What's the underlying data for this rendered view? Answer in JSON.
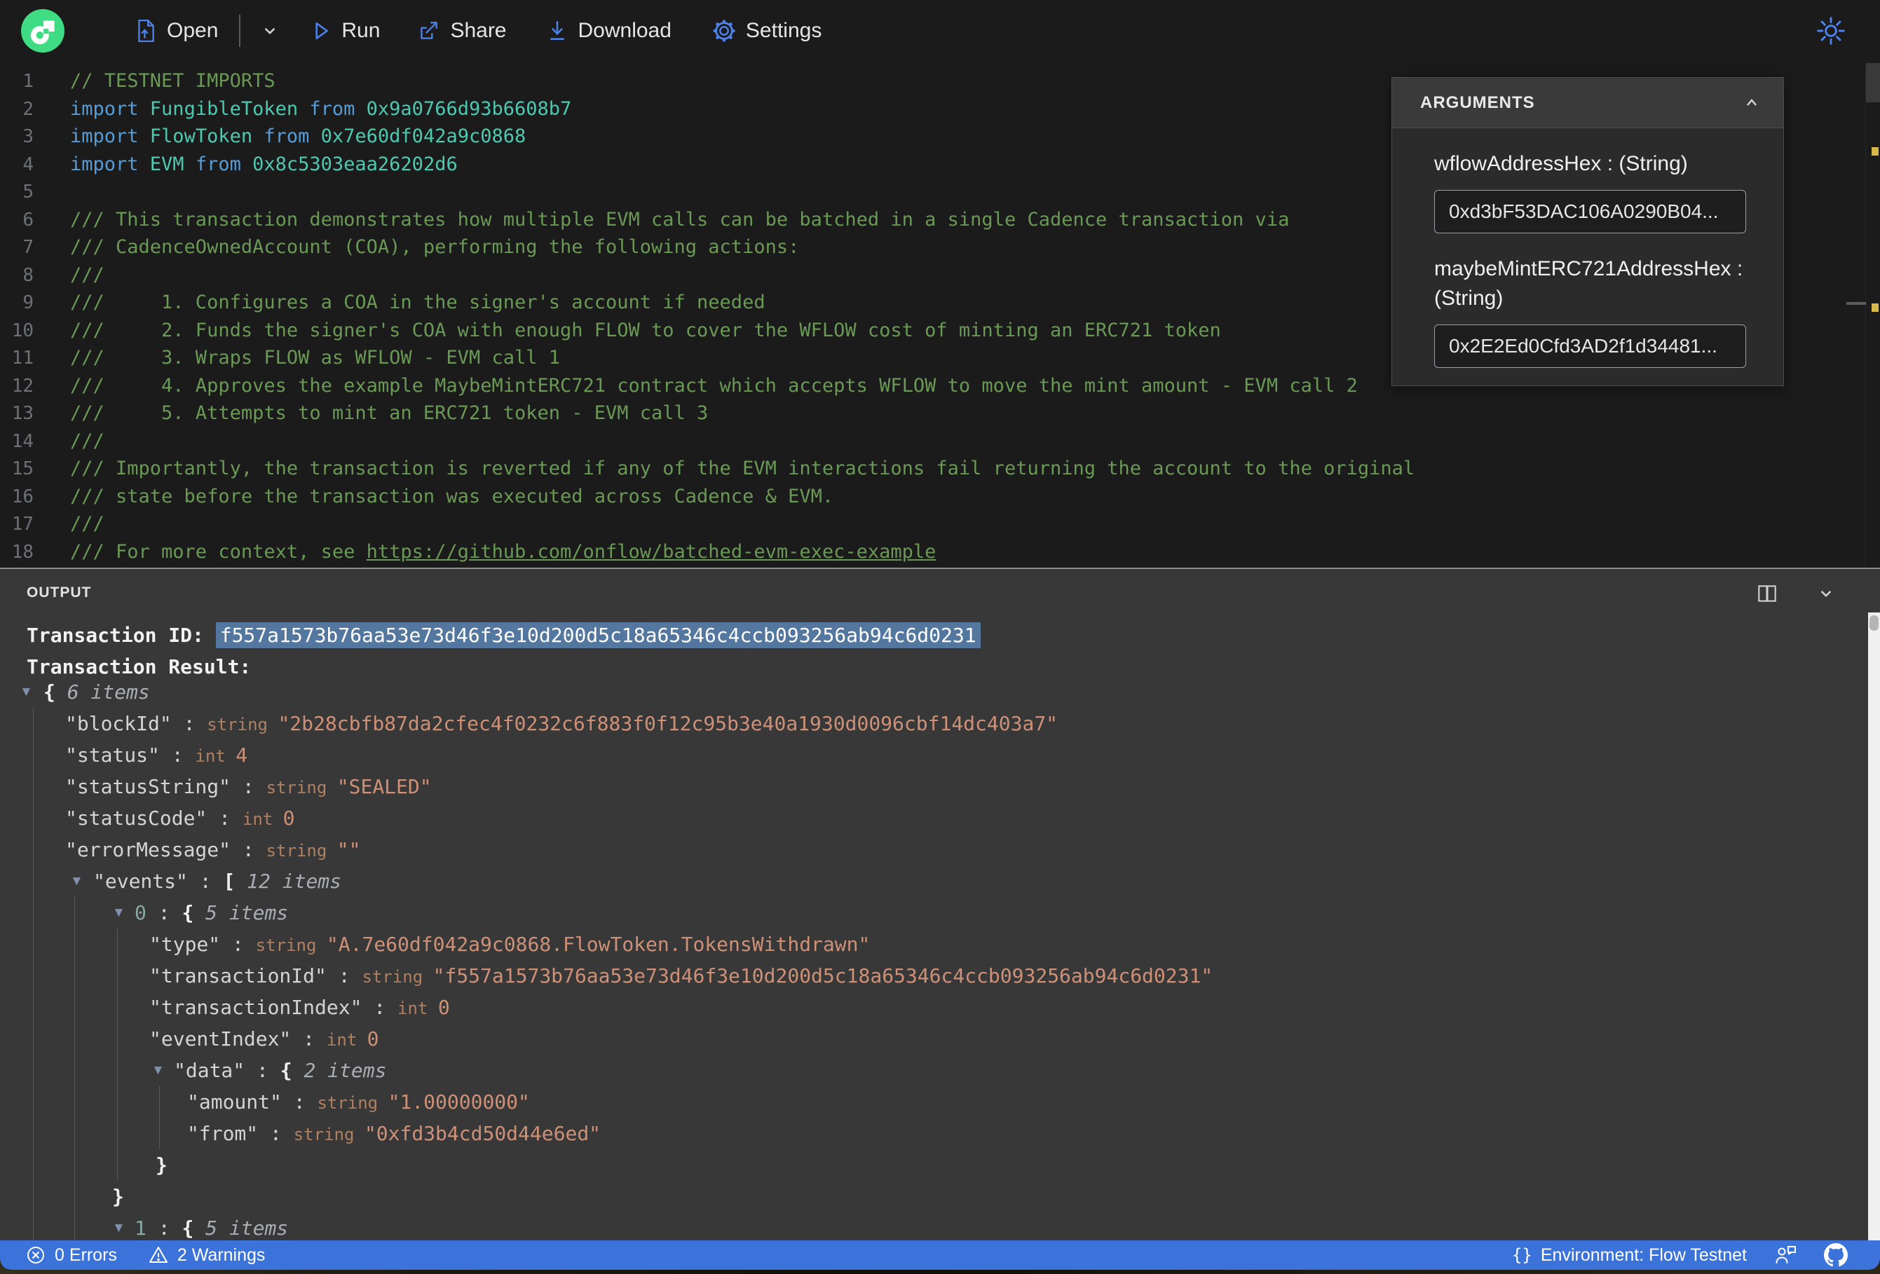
{
  "colors": {
    "accent_blue": "#4d82ec",
    "flow_green": "#3fdc84",
    "status_bar_blue": "#3b73da",
    "selection_blue": "#54779f",
    "string_orange": "#CE9178",
    "comment_green": "#6A9955",
    "keyword_blue": "#569CD6",
    "type_teal": "#4EC9B0",
    "warning_yellow": "#d7b94b"
  },
  "toolbar": {
    "open": "Open",
    "run": "Run",
    "share": "Share",
    "download": "Download",
    "settings": "Settings"
  },
  "editor": {
    "lines": [
      {
        "n": "1",
        "toks": [
          [
            "cm",
            "// TESTNET IMPORTS"
          ]
        ]
      },
      {
        "n": "2",
        "toks": [
          [
            "kw",
            "import "
          ],
          [
            "ty",
            "FungibleToken "
          ],
          [
            "kw",
            "from "
          ],
          [
            "ty",
            "0x9a0766d93b6608b7"
          ]
        ]
      },
      {
        "n": "3",
        "toks": [
          [
            "kw",
            "import "
          ],
          [
            "ty",
            "FlowToken "
          ],
          [
            "kw",
            "from "
          ],
          [
            "ty",
            "0x7e60df042a9c0868"
          ]
        ]
      },
      {
        "n": "4",
        "toks": [
          [
            "kw",
            "import "
          ],
          [
            "ty",
            "EVM "
          ],
          [
            "kw",
            "from "
          ],
          [
            "ty",
            "0x8c5303eaa26202d6"
          ]
        ]
      },
      {
        "n": "5",
        "toks": []
      },
      {
        "n": "6",
        "toks": [
          [
            "cm",
            "/// This transaction demonstrates how multiple EVM calls can be batched in a single Cadence transaction via"
          ]
        ]
      },
      {
        "n": "7",
        "toks": [
          [
            "cm",
            "/// CadenceOwnedAccount (COA), performing the following actions:"
          ]
        ]
      },
      {
        "n": "8",
        "toks": [
          [
            "cm",
            "///"
          ]
        ]
      },
      {
        "n": "9",
        "toks": [
          [
            "cm",
            "///     1. Configures a COA in the signer's account if needed"
          ]
        ]
      },
      {
        "n": "10",
        "toks": [
          [
            "cm",
            "///     2. Funds the signer's COA with enough FLOW to cover the WFLOW cost of minting an ERC721 token"
          ]
        ]
      },
      {
        "n": "11",
        "toks": [
          [
            "cm",
            "///     3. Wraps FLOW as WFLOW - EVM call 1"
          ]
        ]
      },
      {
        "n": "12",
        "toks": [
          [
            "cm",
            "///     4. Approves the example MaybeMintERC721 contract which accepts WFLOW to move the mint amount - EVM call 2"
          ]
        ]
      },
      {
        "n": "13",
        "toks": [
          [
            "cm",
            "///     5. Attempts to mint an ERC721 token - EVM call 3"
          ]
        ]
      },
      {
        "n": "14",
        "toks": [
          [
            "cm",
            "///"
          ]
        ]
      },
      {
        "n": "15",
        "toks": [
          [
            "cm",
            "/// Importantly, the transaction is reverted if any of the EVM interactions fail returning the account to the original"
          ]
        ]
      },
      {
        "n": "16",
        "toks": [
          [
            "cm",
            "/// state before the transaction was executed across Cadence & EVM."
          ]
        ]
      },
      {
        "n": "17",
        "toks": [
          [
            "cm",
            "///"
          ]
        ]
      },
      {
        "n": "18",
        "toks": [
          [
            "cm",
            "/// For more context, see "
          ],
          [
            "lk",
            "https://github.com/onflow/batched-evm-exec-example"
          ]
        ]
      }
    ]
  },
  "arguments_panel": {
    "title": "ARGUMENTS",
    "args": [
      {
        "label": "wflowAddressHex : (String)",
        "value": "0xd3bF53DAC106A0290B04..."
      },
      {
        "label": "maybeMintERC721AddressHex : (String)",
        "value": "0x2E2Ed0Cfd3AD2f1d34481..."
      }
    ]
  },
  "output": {
    "title": "OUTPUT",
    "tx_id_label": "Transaction ID: ",
    "tx_id": "f557a1573b76aa53e73d46f3e10d200d5c18a65346c4ccb093256ab94c6d0231",
    "result_label": "Transaction Result:",
    "rows": [
      {
        "ind": 62,
        "tri": 28,
        "g": [],
        "toks": [
          [
            "b",
            "{ "
          ],
          [
            "i",
            "6 items"
          ]
        ]
      },
      {
        "ind": 93,
        "g": [
          47
        ],
        "toks": [
          [
            "k",
            "\"blockId\""
          ],
          [
            "p",
            " : "
          ],
          [
            "t",
            "string "
          ],
          [
            "s",
            "\"2b28cbfb87da2cfec4f0232c6f883f0f12c95b3e40a1930d0096cbf14dc403a7\""
          ]
        ]
      },
      {
        "ind": 93,
        "g": [
          47
        ],
        "toks": [
          [
            "k",
            "\"status\""
          ],
          [
            "p",
            " : "
          ],
          [
            "t",
            "int "
          ],
          [
            "n",
            "4"
          ]
        ]
      },
      {
        "ind": 93,
        "g": [
          47
        ],
        "toks": [
          [
            "k",
            "\"statusString\""
          ],
          [
            "p",
            " : "
          ],
          [
            "t",
            "string "
          ],
          [
            "s",
            "\"SEALED\""
          ]
        ]
      },
      {
        "ind": 93,
        "g": [
          47
        ],
        "toks": [
          [
            "k",
            "\"statusCode\""
          ],
          [
            "p",
            " : "
          ],
          [
            "t",
            "int "
          ],
          [
            "n",
            "0"
          ]
        ]
      },
      {
        "ind": 93,
        "g": [
          47
        ],
        "toks": [
          [
            "k",
            "\"errorMessage\""
          ],
          [
            "p",
            " : "
          ],
          [
            "t",
            "string "
          ],
          [
            "s",
            "\"\""
          ]
        ]
      },
      {
        "ind": 133,
        "tri": 100,
        "g": [
          47
        ],
        "toks": [
          [
            "k",
            "\"events\""
          ],
          [
            "p",
            " : "
          ],
          [
            "b",
            "[ "
          ],
          [
            "i",
            "12 items"
          ]
        ]
      },
      {
        "ind": 192,
        "tri": 160,
        "g": [
          47,
          106
        ],
        "toks": [
          [
            "x",
            "0"
          ],
          [
            "p",
            " : "
          ],
          [
            "b",
            "{ "
          ],
          [
            "i",
            "5 items"
          ]
        ]
      },
      {
        "ind": 213,
        "g": [
          47,
          106,
          167
        ],
        "toks": [
          [
            "k",
            "\"type\""
          ],
          [
            "p",
            " : "
          ],
          [
            "t",
            "string "
          ],
          [
            "s",
            "\"A.7e60df042a9c0868.FlowToken.TokensWithdrawn\""
          ]
        ]
      },
      {
        "ind": 213,
        "g": [
          47,
          106,
          167
        ],
        "toks": [
          [
            "k",
            "\"transactionId\""
          ],
          [
            "p",
            " : "
          ],
          [
            "t",
            "string "
          ],
          [
            "s",
            "\"f557a1573b76aa53e73d46f3e10d200d5c18a65346c4ccb093256ab94c6d0231\""
          ]
        ]
      },
      {
        "ind": 213,
        "g": [
          47,
          106,
          167
        ],
        "toks": [
          [
            "k",
            "\"transactionIndex\""
          ],
          [
            "p",
            " : "
          ],
          [
            "t",
            "int "
          ],
          [
            "n",
            "0"
          ]
        ]
      },
      {
        "ind": 213,
        "g": [
          47,
          106,
          167
        ],
        "toks": [
          [
            "k",
            "\"eventIndex\""
          ],
          [
            "p",
            " : "
          ],
          [
            "t",
            "int "
          ],
          [
            "n",
            "0"
          ]
        ]
      },
      {
        "ind": 248,
        "tri": 216,
        "g": [
          47,
          106,
          167
        ],
        "toks": [
          [
            "k",
            "\"data\""
          ],
          [
            "p",
            " : "
          ],
          [
            "b",
            "{ "
          ],
          [
            "i",
            "2 items"
          ]
        ]
      },
      {
        "ind": 267,
        "g": [
          47,
          106,
          167,
          227
        ],
        "toks": [
          [
            "k",
            "\"amount\""
          ],
          [
            "p",
            " : "
          ],
          [
            "t",
            "string "
          ],
          [
            "s",
            "\"1.00000000\""
          ]
        ]
      },
      {
        "ind": 267,
        "g": [
          47,
          106,
          167,
          227
        ],
        "toks": [
          [
            "k",
            "\"from\""
          ],
          [
            "p",
            " : "
          ],
          [
            "t",
            "string "
          ],
          [
            "s",
            "\"0xfd3b4cd50d44e6ed\""
          ]
        ]
      },
      {
        "ind": 222,
        "g": [
          47,
          106,
          167
        ],
        "toks": [
          [
            "b",
            "}"
          ]
        ]
      },
      {
        "ind": 160,
        "g": [
          47,
          106
        ],
        "toks": [
          [
            "b",
            "}"
          ]
        ]
      },
      {
        "ind": 192,
        "tri": 160,
        "g": [
          47,
          106
        ],
        "toks": [
          [
            "x",
            "1"
          ],
          [
            "p",
            " : "
          ],
          [
            "b",
            "{ "
          ],
          [
            "i",
            "5 items"
          ]
        ]
      }
    ]
  },
  "statusbar": {
    "errors": "0 Errors",
    "warnings": "2 Warnings",
    "environment": "Environment: Flow Testnet",
    "braces": "{}"
  }
}
